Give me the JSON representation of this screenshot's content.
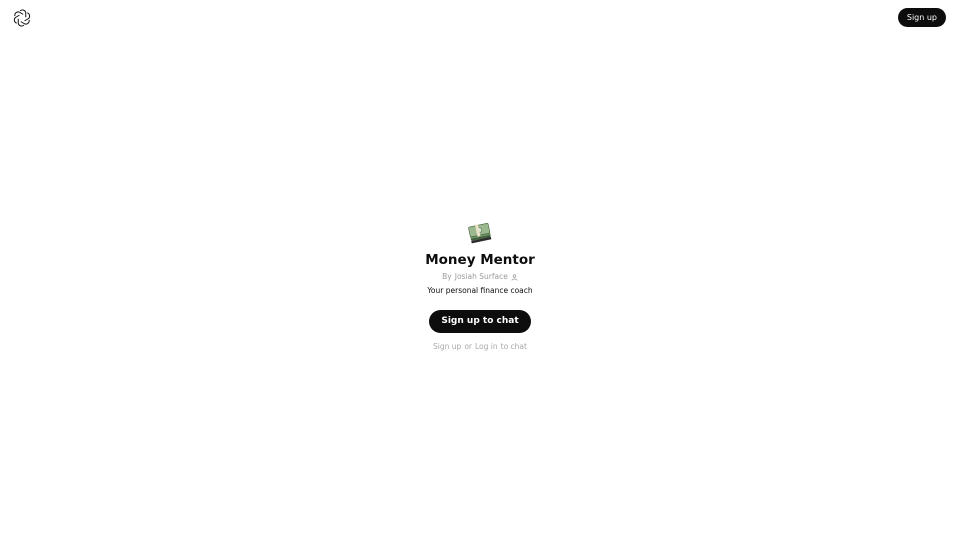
{
  "header": {
    "logo_icon": "openai-logo-icon",
    "signup_label": "Sign up"
  },
  "gpt": {
    "avatar_icon": "money-stack-icon",
    "name": "Money Mentor",
    "by_prefix": "By",
    "author": "Josiah Surface",
    "author_icon": "person-icon",
    "description": "Your personal finance coach"
  },
  "actions": {
    "chat_button_label": "Sign up to chat",
    "footer_signup_link": "Sign up",
    "footer_or": "or",
    "footer_login_link": "Log in",
    "footer_suffix": "to chat"
  },
  "colors": {
    "primary_button": "#0d0d0d",
    "muted_text": "#9b9b9b",
    "background": "#ffffff"
  }
}
